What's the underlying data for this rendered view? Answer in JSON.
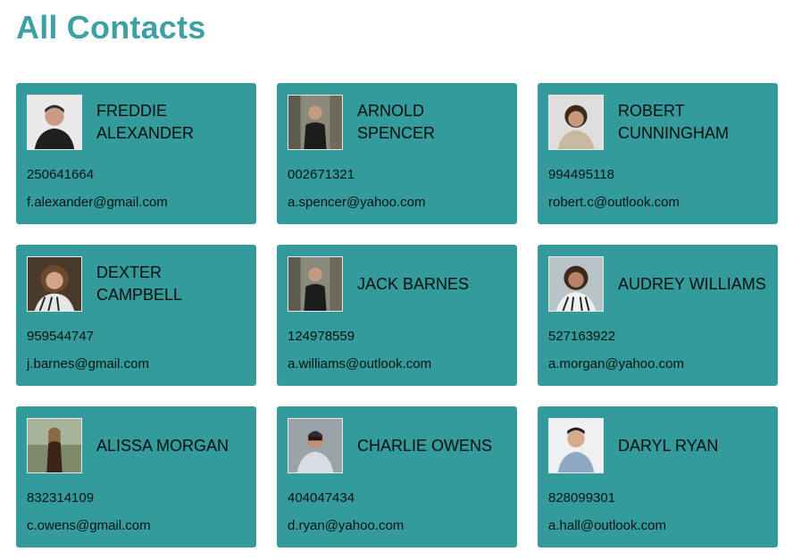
{
  "page": {
    "title": "All Contacts"
  },
  "contacts": [
    {
      "name": "Freddie Alexander",
      "phone": "250641664",
      "email": "f.alexander@gmail.com",
      "avatar": "person-portrait"
    },
    {
      "name": "Arnold Spencer",
      "phone": "002671321",
      "email": "a.spencer@yahoo.com",
      "avatar": "person-portrait"
    },
    {
      "name": "Robert Cunningham",
      "phone": "994495118",
      "email": "robert.c@outlook.com",
      "avatar": "person-portrait"
    },
    {
      "name": "Dexter Campbell",
      "phone": "959544747",
      "email": "j.barnes@gmail.com",
      "avatar": "person-portrait"
    },
    {
      "name": "Jack Barnes",
      "phone": "124978559",
      "email": "a.williams@outlook.com",
      "avatar": "person-portrait"
    },
    {
      "name": "Audrey Williams",
      "phone": "527163922",
      "email": "a.morgan@yahoo.com",
      "avatar": "person-portrait"
    },
    {
      "name": "Alissa Morgan",
      "phone": "832314109",
      "email": "c.owens@gmail.com",
      "avatar": "person-portrait"
    },
    {
      "name": "Charlie Owens",
      "phone": "404047434",
      "email": "d.ryan@yahoo.com",
      "avatar": "person-portrait"
    },
    {
      "name": "Daryl Ryan",
      "phone": "828099301",
      "email": "a.hall@outlook.com",
      "avatar": "person-portrait"
    }
  ],
  "colors": {
    "title": "#3fa0a3",
    "card_background": "#339b9c",
    "text": "#111111"
  }
}
